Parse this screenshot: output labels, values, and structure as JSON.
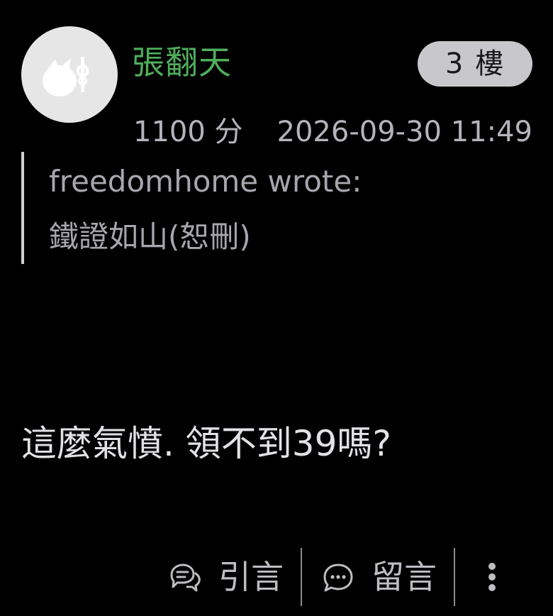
{
  "post": {
    "username": "張翻天",
    "floor": "3 樓",
    "score": "1100 分",
    "timestamp": "2026-09-30 11:49",
    "quote": {
      "author_line": "freedomhome wrote:",
      "text": "鐵證如山(恕刪)"
    },
    "body": "這麼氣憤. 領不到39嗎?"
  },
  "actions": {
    "quote_label": "引言",
    "comment_label": "留言"
  },
  "icons": {
    "avatar": "avatar-figure-icon",
    "quote": "quote-bubbles-icon",
    "comment": "comment-bubble-icon",
    "more": "more-vertical-icon"
  },
  "colors": {
    "background": "#000000",
    "username": "#4fae5b",
    "badge_bg": "#c8c8cc",
    "text": "#e2e2e6",
    "muted": "#b4b4bc"
  }
}
